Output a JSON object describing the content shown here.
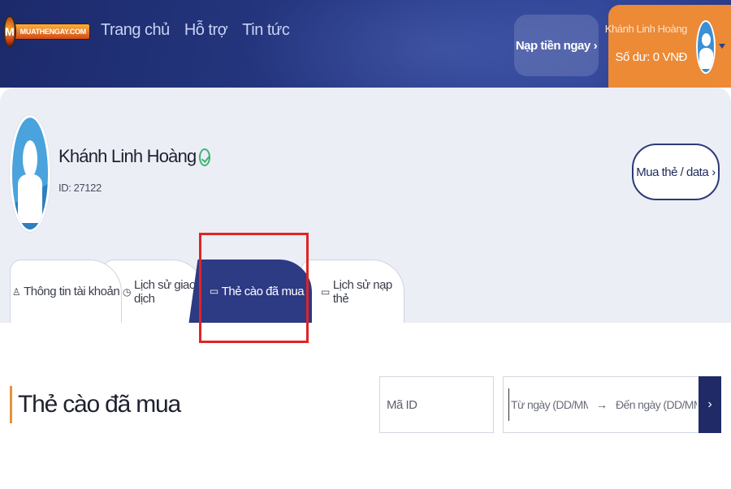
{
  "header": {
    "logo_text": "MUATHENGAY.COM",
    "logo_letter": "M",
    "nav": [
      "Trang chủ",
      "Hỗ trợ",
      "Tin tức"
    ],
    "topup_label": "Nạp tiền ngay",
    "topup_arrow": "›",
    "user_name": "Khánh Linh Hoàng",
    "balance": "Số dư: 0 VNĐ"
  },
  "profile": {
    "name": "Khánh Linh Hoàng",
    "id_text": "ID: 27122",
    "buy_label": "Mua thẻ / data",
    "buy_arrow": "›"
  },
  "tabs": [
    {
      "icon": "user-icon",
      "glyph": "♙",
      "label": "Thông tin tài khoản",
      "active": false
    },
    {
      "icon": "clock-icon",
      "glyph": "◷",
      "label": "Lịch sử giao dịch",
      "active": false
    },
    {
      "icon": "card-icon",
      "glyph": "▭",
      "label": "Thẻ cào đã mua",
      "active": true
    },
    {
      "icon": "card-icon",
      "glyph": "▭",
      "label": "Lịch sử nạp thẻ",
      "active": false
    }
  ],
  "content": {
    "title": "Thẻ cào đã mua",
    "id_placeholder": "Mã ID",
    "from_placeholder": "Từ ngày (DD/MM/YY",
    "arrow": "→",
    "to_placeholder": "Đến ngày (DD/MM/Y",
    "submit_glyph": "›"
  },
  "colors": {
    "header_bg": "#24357d",
    "accent_orange": "#ec8a36",
    "active_tab": "#2d3a84",
    "highlight": "#e02424"
  }
}
